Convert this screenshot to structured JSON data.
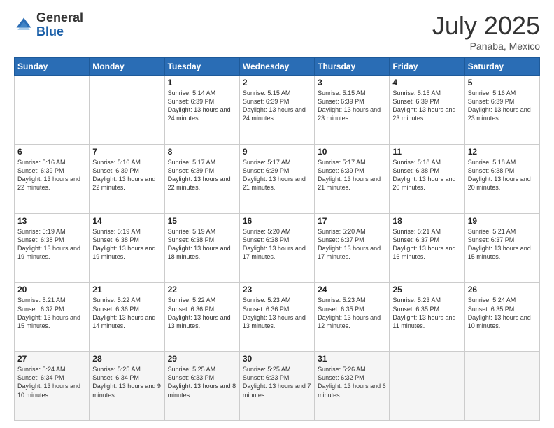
{
  "logo": {
    "general": "General",
    "blue": "Blue"
  },
  "title": "July 2025",
  "location": "Panaba, Mexico",
  "days_of_week": [
    "Sunday",
    "Monday",
    "Tuesday",
    "Wednesday",
    "Thursday",
    "Friday",
    "Saturday"
  ],
  "weeks": [
    [
      {
        "day": "",
        "info": ""
      },
      {
        "day": "",
        "info": ""
      },
      {
        "day": "1",
        "info": "Sunrise: 5:14 AM\nSunset: 6:39 PM\nDaylight: 13 hours and 24 minutes."
      },
      {
        "day": "2",
        "info": "Sunrise: 5:15 AM\nSunset: 6:39 PM\nDaylight: 13 hours and 24 minutes."
      },
      {
        "day": "3",
        "info": "Sunrise: 5:15 AM\nSunset: 6:39 PM\nDaylight: 13 hours and 23 minutes."
      },
      {
        "day": "4",
        "info": "Sunrise: 5:15 AM\nSunset: 6:39 PM\nDaylight: 13 hours and 23 minutes."
      },
      {
        "day": "5",
        "info": "Sunrise: 5:16 AM\nSunset: 6:39 PM\nDaylight: 13 hours and 23 minutes."
      }
    ],
    [
      {
        "day": "6",
        "info": "Sunrise: 5:16 AM\nSunset: 6:39 PM\nDaylight: 13 hours and 22 minutes."
      },
      {
        "day": "7",
        "info": "Sunrise: 5:16 AM\nSunset: 6:39 PM\nDaylight: 13 hours and 22 minutes."
      },
      {
        "day": "8",
        "info": "Sunrise: 5:17 AM\nSunset: 6:39 PM\nDaylight: 13 hours and 22 minutes."
      },
      {
        "day": "9",
        "info": "Sunrise: 5:17 AM\nSunset: 6:39 PM\nDaylight: 13 hours and 21 minutes."
      },
      {
        "day": "10",
        "info": "Sunrise: 5:17 AM\nSunset: 6:39 PM\nDaylight: 13 hours and 21 minutes."
      },
      {
        "day": "11",
        "info": "Sunrise: 5:18 AM\nSunset: 6:38 PM\nDaylight: 13 hours and 20 minutes."
      },
      {
        "day": "12",
        "info": "Sunrise: 5:18 AM\nSunset: 6:38 PM\nDaylight: 13 hours and 20 minutes."
      }
    ],
    [
      {
        "day": "13",
        "info": "Sunrise: 5:19 AM\nSunset: 6:38 PM\nDaylight: 13 hours and 19 minutes."
      },
      {
        "day": "14",
        "info": "Sunrise: 5:19 AM\nSunset: 6:38 PM\nDaylight: 13 hours and 19 minutes."
      },
      {
        "day": "15",
        "info": "Sunrise: 5:19 AM\nSunset: 6:38 PM\nDaylight: 13 hours and 18 minutes."
      },
      {
        "day": "16",
        "info": "Sunrise: 5:20 AM\nSunset: 6:38 PM\nDaylight: 13 hours and 17 minutes."
      },
      {
        "day": "17",
        "info": "Sunrise: 5:20 AM\nSunset: 6:37 PM\nDaylight: 13 hours and 17 minutes."
      },
      {
        "day": "18",
        "info": "Sunrise: 5:21 AM\nSunset: 6:37 PM\nDaylight: 13 hours and 16 minutes."
      },
      {
        "day": "19",
        "info": "Sunrise: 5:21 AM\nSunset: 6:37 PM\nDaylight: 13 hours and 15 minutes."
      }
    ],
    [
      {
        "day": "20",
        "info": "Sunrise: 5:21 AM\nSunset: 6:37 PM\nDaylight: 13 hours and 15 minutes."
      },
      {
        "day": "21",
        "info": "Sunrise: 5:22 AM\nSunset: 6:36 PM\nDaylight: 13 hours and 14 minutes."
      },
      {
        "day": "22",
        "info": "Sunrise: 5:22 AM\nSunset: 6:36 PM\nDaylight: 13 hours and 13 minutes."
      },
      {
        "day": "23",
        "info": "Sunrise: 5:23 AM\nSunset: 6:36 PM\nDaylight: 13 hours and 13 minutes."
      },
      {
        "day": "24",
        "info": "Sunrise: 5:23 AM\nSunset: 6:35 PM\nDaylight: 13 hours and 12 minutes."
      },
      {
        "day": "25",
        "info": "Sunrise: 5:23 AM\nSunset: 6:35 PM\nDaylight: 13 hours and 11 minutes."
      },
      {
        "day": "26",
        "info": "Sunrise: 5:24 AM\nSunset: 6:35 PM\nDaylight: 13 hours and 10 minutes."
      }
    ],
    [
      {
        "day": "27",
        "info": "Sunrise: 5:24 AM\nSunset: 6:34 PM\nDaylight: 13 hours and 10 minutes."
      },
      {
        "day": "28",
        "info": "Sunrise: 5:25 AM\nSunset: 6:34 PM\nDaylight: 13 hours and 9 minutes."
      },
      {
        "day": "29",
        "info": "Sunrise: 5:25 AM\nSunset: 6:33 PM\nDaylight: 13 hours and 8 minutes."
      },
      {
        "day": "30",
        "info": "Sunrise: 5:25 AM\nSunset: 6:33 PM\nDaylight: 13 hours and 7 minutes."
      },
      {
        "day": "31",
        "info": "Sunrise: 5:26 AM\nSunset: 6:32 PM\nDaylight: 13 hours and 6 minutes."
      },
      {
        "day": "",
        "info": ""
      },
      {
        "day": "",
        "info": ""
      }
    ]
  ]
}
